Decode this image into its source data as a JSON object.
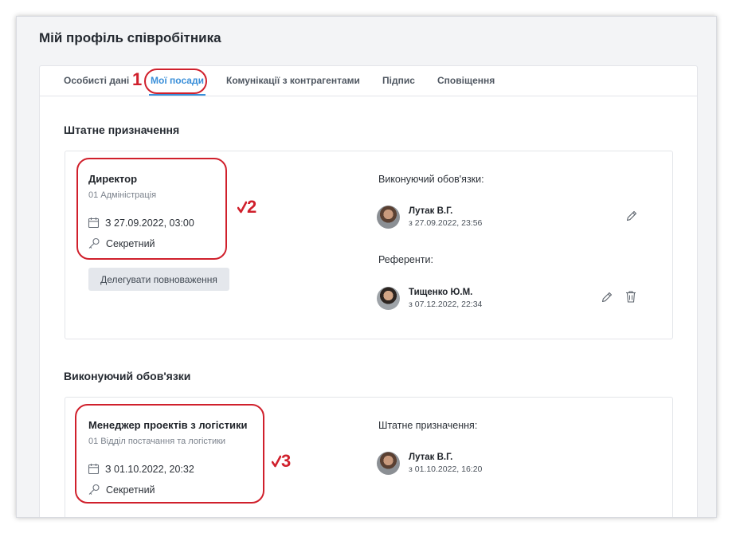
{
  "page": {
    "title": "Мій профіль співробітника"
  },
  "tabs": [
    {
      "label": "Особисті дані",
      "active": false
    },
    {
      "label": "Мої посади",
      "active": true
    },
    {
      "label": "Комунікації з контрагентами",
      "active": false
    },
    {
      "label": "Підпис",
      "active": false
    },
    {
      "label": "Сповіщення",
      "active": false
    }
  ],
  "sections": {
    "staff": {
      "title": "Штатне призначення",
      "position": {
        "name": "Директор",
        "department": "01 Адміністрація",
        "date": "З 27.09.2022, 03:00",
        "access": "Секретний",
        "delegate_button": "Делегувати повноваження"
      },
      "acting": {
        "label": "Виконуючий обов'язки:",
        "person": {
          "name": "Лутак В.Г.",
          "since": "з 27.09.2022, 23:56"
        }
      },
      "referents": {
        "label": "Референти:",
        "person": {
          "name": "Тищенко Ю.М.",
          "since": "з 07.12.2022, 22:34"
        }
      }
    },
    "acting_duties": {
      "title": "Виконуючий обов'язки",
      "position": {
        "name": "Менеджер проектів з логістики",
        "department": "01 Відділ постачання та логістики",
        "date": "З 01.10.2022, 20:32",
        "access": "Секретний"
      },
      "staff_assignment": {
        "label": "Штатне призначення:",
        "person": {
          "name": "Лутак В.Г.",
          "since": "з 01.10.2022, 16:20"
        }
      }
    }
  },
  "annotations": [
    {
      "label": "1"
    },
    {
      "label": "2"
    },
    {
      "label": "3"
    }
  ],
  "colors": {
    "accent": "#3a8fd9",
    "annotation": "#d0202c"
  },
  "icons": [
    "calendar-icon",
    "key-icon",
    "pencil-icon",
    "trash-icon",
    "checkmark-icon"
  ]
}
